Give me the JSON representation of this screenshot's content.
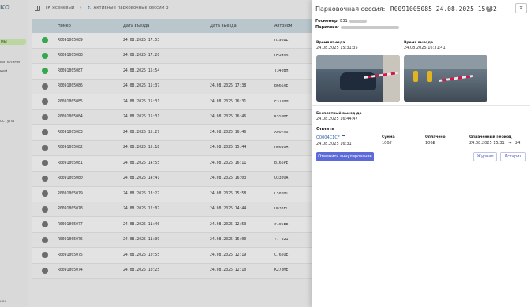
{
  "sidebar": {
    "logo": "KO",
    "items": [
      {
        "label": "мы",
        "active": true
      },
      {
        "label": "вателями",
        "active": false
      },
      {
        "label": "кей",
        "active": false
      },
      {
        "label": "оступа",
        "active": false
      }
    ],
    "footer": "иво"
  },
  "header": {
    "breadcrumb_1": "ТК Ясеневый",
    "breadcrumb_2": "Активные парковочные сессии 3"
  },
  "table": {
    "columns": [
      "Номер",
      "Дата въезда",
      "Дата выезда",
      "Автоном"
    ],
    "rows": [
      {
        "status": "green",
        "number": "R0091005089",
        "in": "24.08.2025 17:53",
        "out": "",
        "auto": "Н190ВЕ"
      },
      {
        "status": "green",
        "number": "R0091005088",
        "in": "24.08.2025 17:20",
        "out": "",
        "auto": "Н434ХК"
      },
      {
        "status": "green",
        "number": "R0091005087",
        "in": "24.08.2025 16:54",
        "out": "",
        "auto": "Т340ВН"
      },
      {
        "status": "gray",
        "number": "R0091005086",
        "in": "24.08.2025 15:37",
        "out": "24.08.2025 17:38",
        "auto": "В666ХЕ"
      },
      {
        "status": "gray",
        "number": "R0091005085",
        "in": "24.08.2025 15:31",
        "out": "24.08.2025 16:31",
        "auto": "Е311ММ"
      },
      {
        "status": "gray",
        "number": "R0091005084",
        "in": "24.08.2025 15:31",
        "out": "24.08.2025 16:46",
        "auto": "К550МЕ"
      },
      {
        "status": "gray",
        "number": "R0091005083",
        "in": "24.08.2025 15:27",
        "out": "24.08.2025 16:46",
        "auto": "Х007ХО"
      },
      {
        "status": "gray",
        "number": "R0091005082",
        "in": "24.08.2025 15:18",
        "out": "24.08.2025 15:44",
        "auto": "Н663ОА"
      },
      {
        "status": "gray",
        "number": "R0091005081",
        "in": "24.08.2025 14:55",
        "out": "24.08.2025 16:11",
        "auto": "В166РЕ"
      },
      {
        "status": "gray",
        "number": "R0091005080",
        "in": "24.08.2025 14:41",
        "out": "24.08.2025 16:03",
        "auto": "О330ОА"
      },
      {
        "status": "gray",
        "number": "R0091005079",
        "in": "24.08.2025 13:27",
        "out": "24.08.2025 15:58",
        "auto": "С582МТ"
      },
      {
        "status": "gray",
        "number": "R0091005078",
        "in": "24.08.2025 12:07",
        "out": "24.08.2025 14:44",
        "auto": "О838ЕС"
      },
      {
        "status": "gray",
        "number": "R0091005077",
        "in": "24.08.2025 11:40",
        "out": "24.08.2025 12:53",
        "auto": "У105ЕЕ"
      },
      {
        "status": "gray",
        "number": "R0091005076",
        "in": "24.08.2025 11:39",
        "out": "24.08.2025 15:00",
        "auto": "+7 921"
      },
      {
        "status": "gray",
        "number": "R0091005075",
        "in": "24.08.2025 10:55",
        "out": "24.08.2025 12:19",
        "auto": "С766ОЕ"
      },
      {
        "status": "gray",
        "number": "R0091005074",
        "in": "24.08.2025 10:25",
        "out": "24.08.2025 12:10",
        "auto": "К270МЕ"
      }
    ]
  },
  "panel": {
    "title": "Парковочная сессия:",
    "session_id": "R0091005085 24.08.2025 15:32",
    "help": "?",
    "close": "×",
    "plate_label": "Госномер:",
    "plate_value": "Е31",
    "parking_label": "Парковка:",
    "entry_time_label": "Время въезда",
    "entry_time": "24.08.2025 15:31:35",
    "exit_time_label": "Время выезда",
    "exit_time": "24.08.2025 16:31:41",
    "free_exit_label": "Бесплатный выезд до",
    "free_exit": "24.08.2025 16:44:47",
    "payment_label": "Оплата",
    "payment_id": "Q0004C1CF",
    "payment_date": "24.08.2025 16:31",
    "sum_label": "Сумма",
    "sum_value": "100₽",
    "paid_label": "Оплачено",
    "paid_value": "100₽",
    "period_label": "Оплаченный период",
    "period_from": "24.08.2025 15:31",
    "period_arrow": "→",
    "period_to": "24",
    "cancel_button": "Отменить аннулирование",
    "journal_button": "Журнал",
    "history_button": "История"
  },
  "colors": {
    "accent": "#5c6bd8",
    "active_dot": "#35a84d",
    "inactive_dot": "#6c6c6c",
    "header_row": "#b9c7cc"
  }
}
